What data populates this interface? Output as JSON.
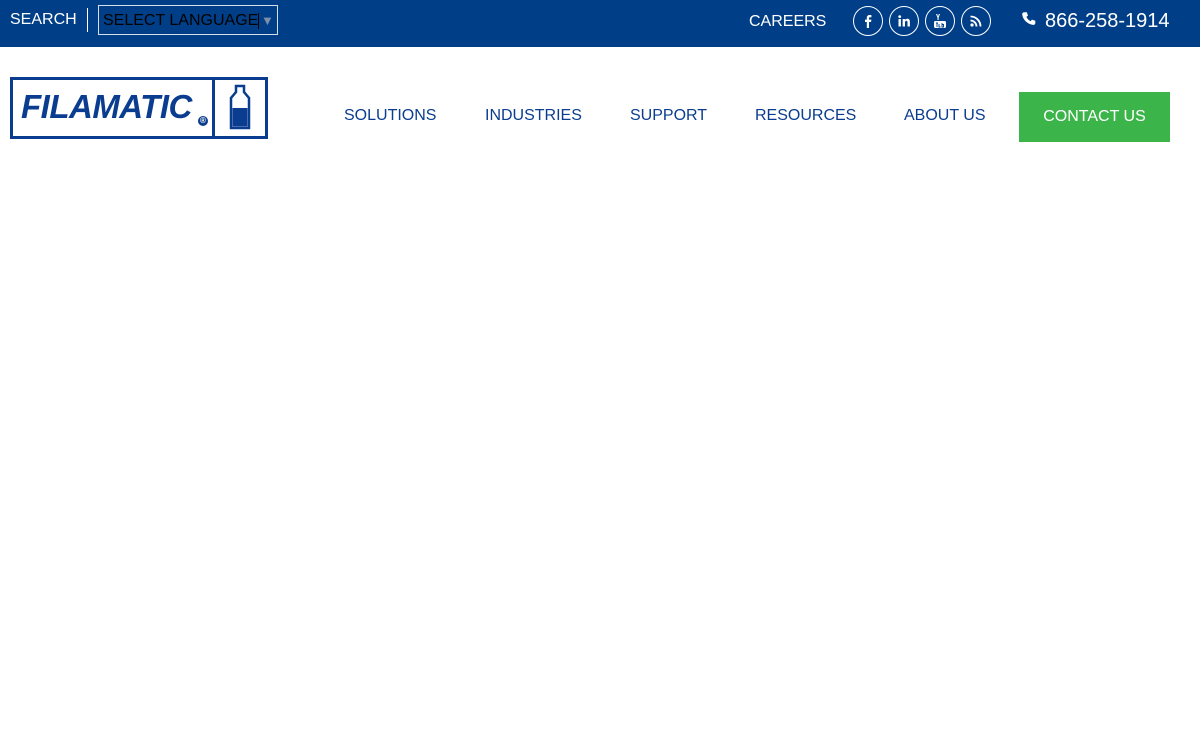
{
  "topbar": {
    "search_label": "SEARCH",
    "language_select": "SELECT LANGUAGE",
    "careers_label": "CAREERS",
    "phone": "866-258-1914",
    "social_icons": [
      "facebook-icon",
      "linkedin-icon",
      "youtube-icon",
      "rss-icon"
    ],
    "background_color": "#003f87"
  },
  "logo": {
    "text": "FILAMATIC",
    "registered_mark": "®"
  },
  "nav": {
    "items": [
      "SOLUTIONS",
      "INDUSTRIES",
      "SUPPORT",
      "RESOURCES",
      "ABOUT US"
    ],
    "contact_label": "CONTACT US",
    "contact_color": "#3bb54a",
    "link_color": "#0a3d8f"
  }
}
